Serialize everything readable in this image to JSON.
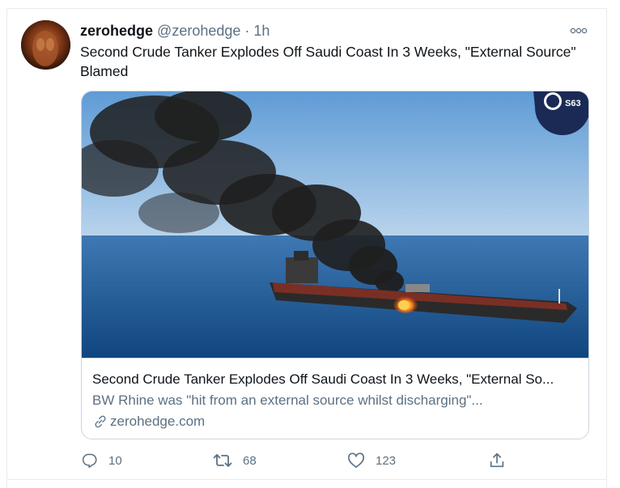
{
  "tweet": {
    "author_name": "zerohedge",
    "author_handle": "@zerohedge",
    "separator": " · ",
    "time": "1h",
    "text": "Second Crude Tanker Explodes Off Saudi Coast In 3 Weeks, \"External Source\" Blamed"
  },
  "card": {
    "title": "Second Crude Tanker Explodes Off Saudi Coast In 3 Weeks, \"External So...",
    "description": "BW Rhine was \"hit from an external source whilst discharging\"...",
    "domain": "zerohedge.com",
    "watermark": "S63"
  },
  "actions": {
    "reply": {
      "icon": "reply-icon",
      "count": "10"
    },
    "retweet": {
      "icon": "retweet-icon",
      "count": "68"
    },
    "like": {
      "icon": "heart-icon",
      "count": "123"
    },
    "share": {
      "icon": "share-icon"
    }
  },
  "colors": {
    "text": "#0f1419",
    "secondary": "#5b7083",
    "border": "#ccd6dd"
  }
}
